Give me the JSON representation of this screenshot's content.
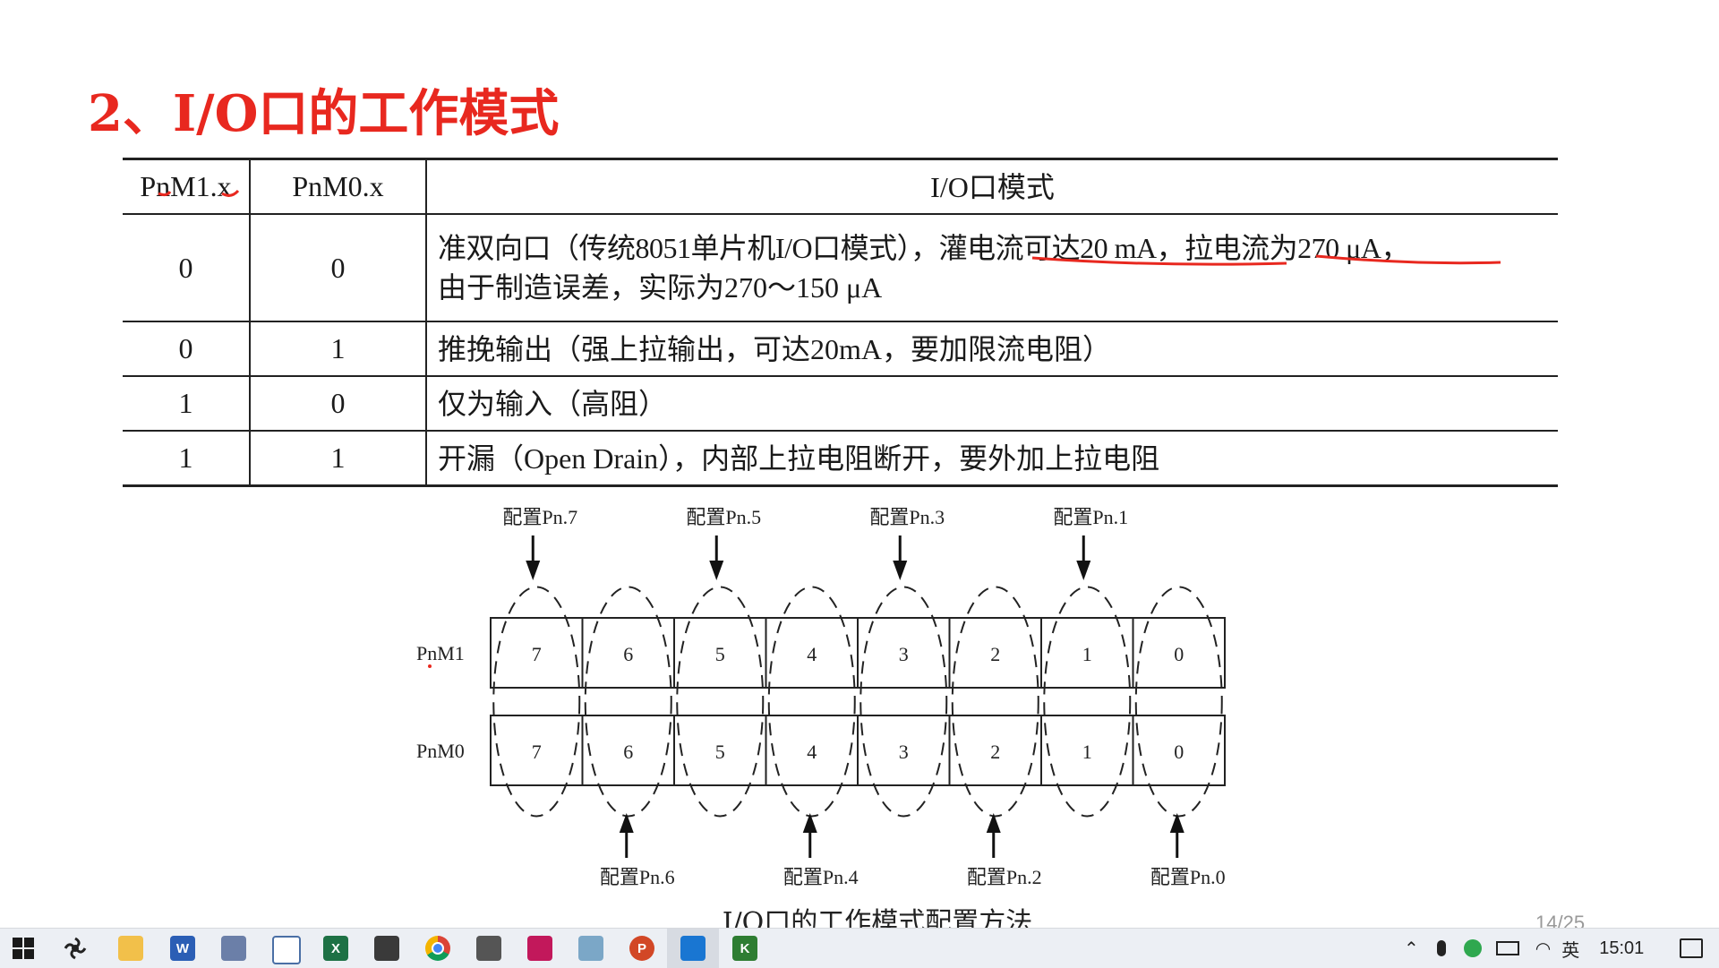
{
  "slide": {
    "title": "2、I/O口的工作模式",
    "table": {
      "headers": [
        "PnM1.x",
        "PnM0.x",
        "I/O口模式"
      ],
      "rows": [
        {
          "m1": "0",
          "m0": "0",
          "line1": "准双向口（传统8051单片机I/O口模式），灌电流可达20 mA，拉电流为270 μA，",
          "line2": "由于制造误差，实际为270～150 μA"
        },
        {
          "m1": "0",
          "m0": "1",
          "line1": "推挽输出（强上拉输出，可达20mA，要加限流电阻）"
        },
        {
          "m1": "1",
          "m0": "0",
          "line1": "仅为输入（高阻）"
        },
        {
          "m1": "1",
          "m0": "1",
          "line1": "开漏（Open Drain），内部上拉电阻断开，要外加上拉电阻"
        }
      ]
    },
    "diagram": {
      "row_labels": [
        "PnM1",
        "PnM0"
      ],
      "bits": [
        "7",
        "6",
        "5",
        "4",
        "3",
        "2",
        "1",
        "0"
      ],
      "top_labels": [
        "配置Pn.7",
        "配置Pn.5",
        "配置Pn.3",
        "配置Pn.1"
      ],
      "bottom_labels": [
        "配置Pn.6",
        "配置Pn.4",
        "配置Pn.2",
        "配置Pn.0"
      ],
      "caption": "I/O口的工作模式配置方法"
    },
    "page_number": "14/25",
    "title_color": "#e8281f",
    "annotation_color": "#e8281f"
  },
  "taskbar": {
    "apps": [
      "start-icon",
      "fan-app-icon",
      "file-explorer-icon",
      "word-icon",
      "building-app-icon",
      "window-app-icon",
      "excel-icon",
      "book-app-icon",
      "chrome-icon",
      "chip-app-icon",
      "wifi-app-icon",
      "pen-app-icon",
      "powerpoint-icon",
      "whiteboard-app-icon",
      "keil-app-icon"
    ],
    "ime": "英",
    "time": "15:01"
  }
}
